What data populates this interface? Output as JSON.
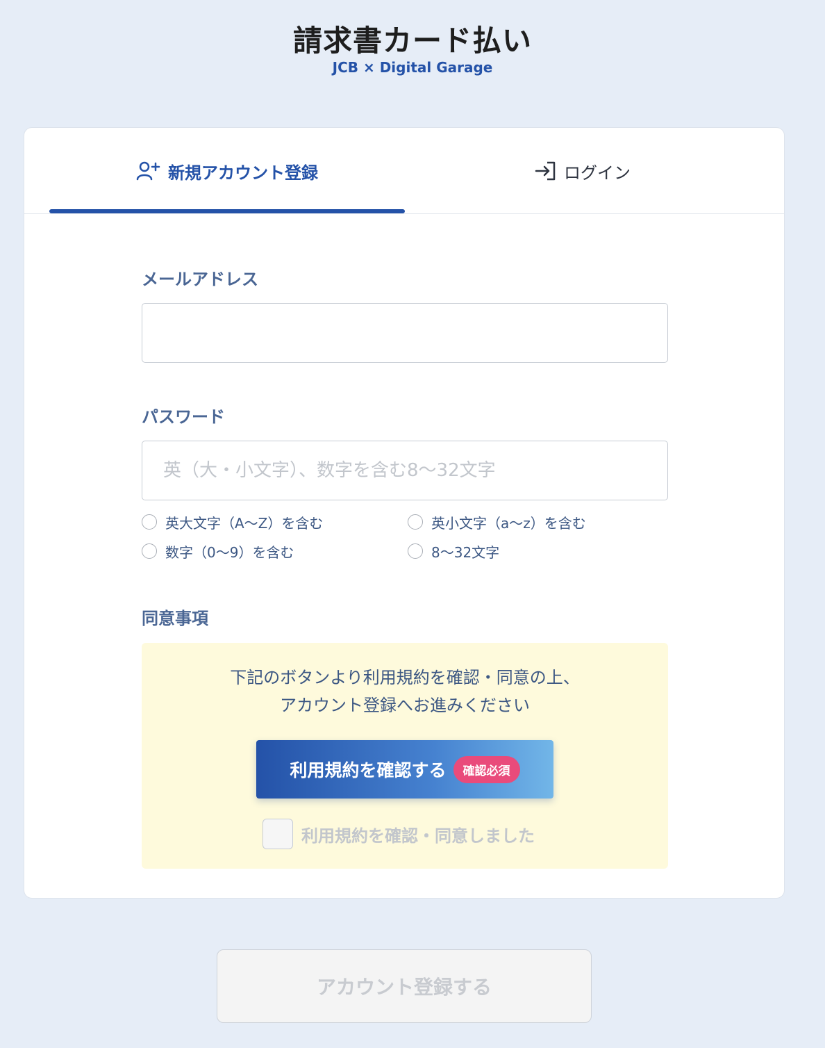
{
  "logo": {
    "title": "請求書カード払い",
    "subtitle": "JCB × Digital Garage"
  },
  "tabs": [
    {
      "label": "新規アカウント登録",
      "icon": "user-plus-icon",
      "active": true
    },
    {
      "label": "ログイン",
      "icon": "login-arrow-icon",
      "active": false
    }
  ],
  "form": {
    "email_label": "メールアドレス",
    "email_value": "",
    "password_label": "パスワード",
    "password_placeholder": "英（大・小文字）、数字を含む8〜32文字",
    "password_rules": [
      "英大文字（A〜Z）を含む",
      "英小文字（a〜z）を含む",
      "数字（0〜9）を含む",
      "8〜32文字"
    ],
    "agreement_label": "同意事項",
    "agreement_text_line1": "下記のボタンより利用規約を確認・同意の上、",
    "agreement_text_line2": "アカウント登録へお進みください",
    "terms_button_label": "利用規約を確認する",
    "terms_badge": "確認必須",
    "agree_checkbox_label": "利用規約を確認・同意しました",
    "agree_checked": false
  },
  "submit_label": "アカウント登録する",
  "colors": {
    "background": "#e6edf7",
    "accent": "#2452a8",
    "badge": "#e94b7b",
    "agreement_bg": "#fefadc"
  }
}
